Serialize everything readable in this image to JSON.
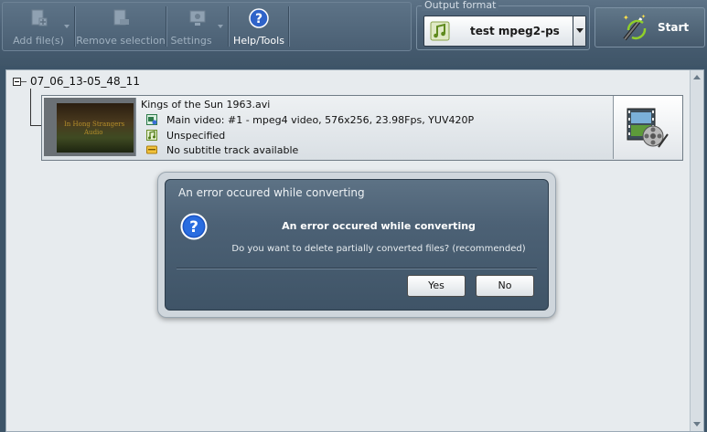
{
  "toolbar": {
    "add_files": "Add file(s)",
    "remove_selection": "Remove selection",
    "settings": "Settings",
    "help_tools": "Help/Tools"
  },
  "output_format": {
    "title": "Output format",
    "selected": "test mpeg2-ps"
  },
  "start": {
    "label": "Start"
  },
  "tree": {
    "folder": "07_06_13-05_48_11",
    "file": {
      "name": "Kings of the Sun 1963.avi",
      "video": "Main video: #1 - mpeg4 video, 576x256, 23.98Fps, YUV420P",
      "audio": "Unspecified",
      "subtitle": "No subtitle track available",
      "thumb_text_1": "In Hong Strangers",
      "thumb_text_2": "Audio"
    }
  },
  "dialog": {
    "title": "An error occured while converting",
    "heading": "An error occured while converting",
    "message": "Do you want to delete partially converted files? (recommended)",
    "yes": "Yes",
    "no": "No"
  },
  "colors": {
    "chrome": "#4b6075",
    "panel": "#e7ebee",
    "dialog": "#4c6175"
  },
  "icons": [
    "add-files-icon",
    "remove-selection-icon",
    "settings-icon",
    "help-icon",
    "music-note-icon",
    "magic-wand-icon",
    "video-info-icon",
    "audio-icon",
    "subtitle-icon",
    "film-reel-icon",
    "question-icon"
  ]
}
